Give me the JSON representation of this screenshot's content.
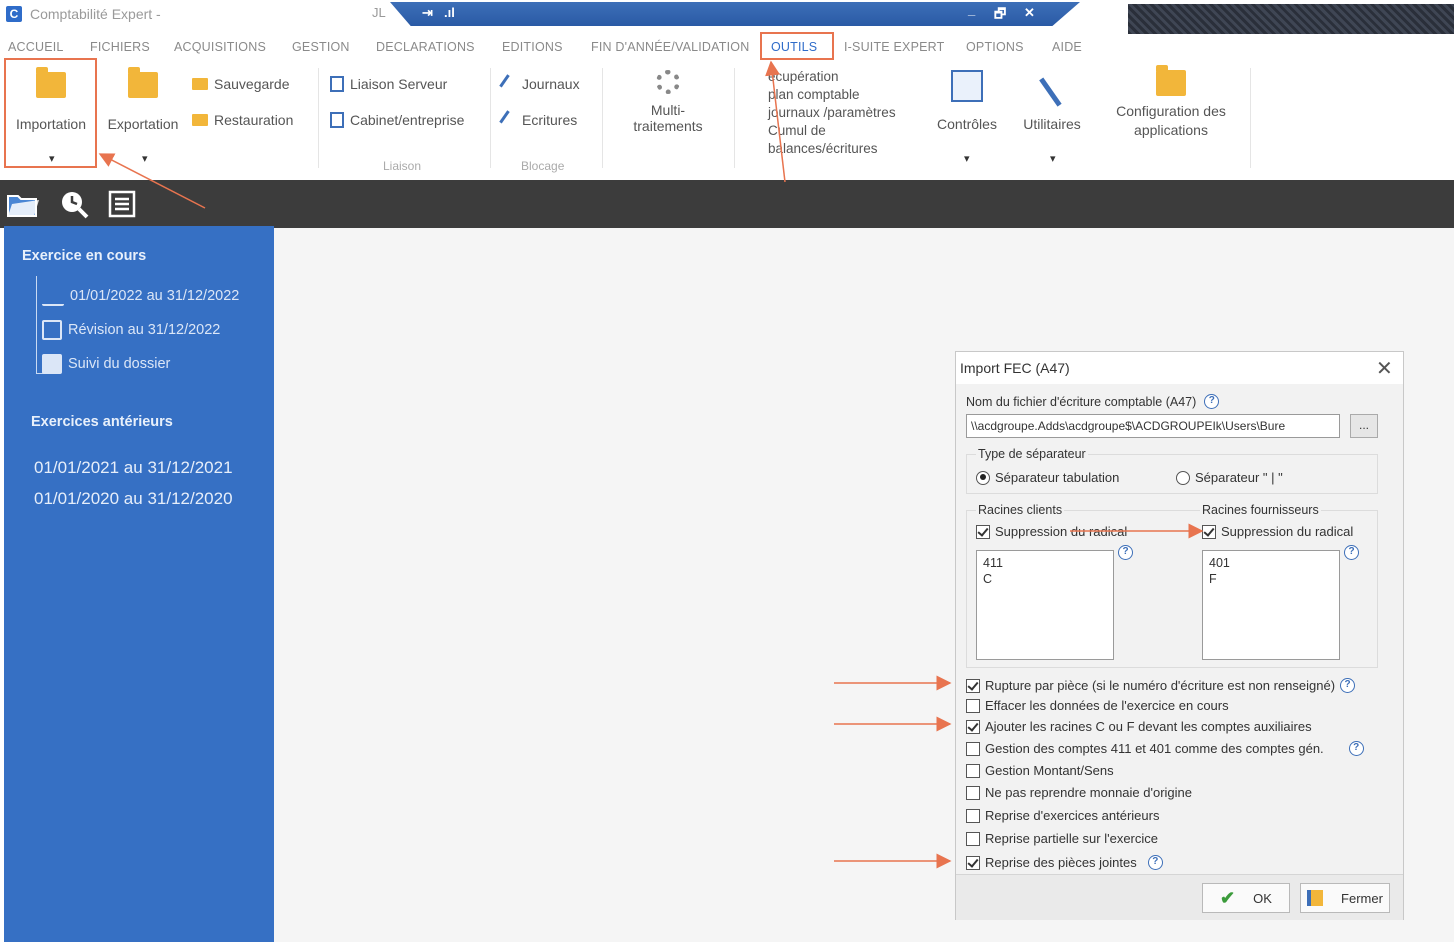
{
  "app": {
    "logo": "C",
    "title": "Comptabilité Expert -",
    "user": "JL"
  },
  "window_controls": {
    "pin": "⇥",
    "signal": ".ıl",
    "minimize": "_",
    "restore": "🗗",
    "close": "✕"
  },
  "menu": {
    "tabs": [
      {
        "label": "ACCUEIL"
      },
      {
        "label": "FICHIERS"
      },
      {
        "label": "ACQUISITIONS"
      },
      {
        "label": "GESTION"
      },
      {
        "label": "DECLARATIONS"
      },
      {
        "label": "EDITIONS"
      },
      {
        "label": "FIN D'ANNÉE/VALIDATION"
      },
      {
        "label": "OUTILS"
      },
      {
        "label": "I-SUITE EXPERT"
      },
      {
        "label": "OPTIONS"
      },
      {
        "label": "AIDE"
      }
    ]
  },
  "ribbon": {
    "importation": "Importation",
    "exportation": "Exportation",
    "sauvegarde": "Sauvegarde",
    "restauration": "Restauration",
    "liaison_serveur": "Liaison Serveur",
    "cabinet_entreprise": "Cabinet/entreprise",
    "group_liaison": "Liaison",
    "journaux": "Journaux",
    "ecritures": "Ecritures",
    "group_blocage": "Blocage",
    "multi_line1": "Multi-",
    "multi_line2": "traitements",
    "recup_line1": "écupération",
    "recup_line2": "plan comptable",
    "recup_line3": "journaux /paramètres",
    "cumul_line1": "Cumul de",
    "cumul_line2": "balances/écritures",
    "controles": "Contrôles",
    "utilitaires": "Utilitaires",
    "config_line1": "Configuration des",
    "config_line2": "applications",
    "dropdown": "▾"
  },
  "sidebar": {
    "current_heading": "Exercice en cours",
    "current_items": [
      {
        "label": "01/01/2022 au 31/12/2022"
      },
      {
        "label": "Révision au 31/12/2022"
      },
      {
        "label": "Suivi du dossier"
      }
    ],
    "previous_heading": "Exercices antérieurs",
    "previous_items": [
      {
        "label": "01/01/2021 au 31/12/2021"
      },
      {
        "label": "01/01/2020 au 31/12/2020"
      }
    ]
  },
  "dialog": {
    "title": "Import FEC (A47)",
    "close": "✕",
    "file_label": "Nom du fichier d'écriture comptable (A47)",
    "file_path": "\\\\acdgroupe.Adds\\acdgroupe$\\ACDGROUPEIk\\Users\\Bure",
    "browse": "...",
    "help": "?",
    "separator_label": "Type de séparateur",
    "sep_tab": "Séparateur tabulation",
    "sep_pipe": "Séparateur \" | \"",
    "clients_label": "Racines clients",
    "clients_suppression": "Suppression du radical",
    "clients_values": [
      "411",
      "C"
    ],
    "suppliers_label": "Racines fournisseurs",
    "suppliers_suppression": "Suppression du radical",
    "suppliers_values": [
      "401",
      "F"
    ],
    "options": [
      {
        "label": "Rupture par pièce (si le numéro d'écriture est non renseigné)",
        "checked": true
      },
      {
        "label": "Effacer les données de l'exercice en cours",
        "checked": false
      },
      {
        "label": "Ajouter les racines C ou F devant les comptes auxiliaires",
        "checked": true
      },
      {
        "label": "Gestion des comptes 411 et 401 comme des comptes gén.",
        "checked": false
      },
      {
        "label": "Gestion Montant/Sens",
        "checked": false
      },
      {
        "label": "Ne pas reprendre monnaie d'origine",
        "checked": false
      },
      {
        "label": "Reprise d'exercices antérieurs",
        "checked": false
      },
      {
        "label": "Reprise partielle sur l'exercice",
        "checked": false
      },
      {
        "label": "Reprise des pièces jointes",
        "checked": true
      }
    ],
    "ok": "OK",
    "fermer": "Fermer"
  },
  "colors": {
    "accent": "#2f6cc9",
    "sidebar": "#3670c4",
    "annotation": "#e8744f"
  }
}
